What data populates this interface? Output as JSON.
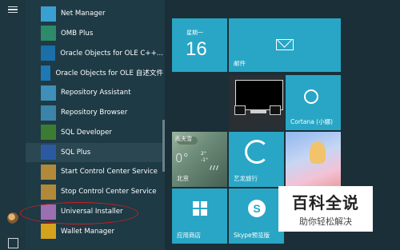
{
  "apps": [
    {
      "label": "Net Manager",
      "icon": "net-manager-icon",
      "color": "#3aa0d1"
    },
    {
      "label": "OMB Plus",
      "icon": "omb-plus-icon",
      "color": "#2d8a6a"
    },
    {
      "label": "Oracle Objects for OLE C++...",
      "icon": "oracle-objects-icon",
      "color": "#1b6fa8"
    },
    {
      "label": "Oracle Objects for OLE 自述文件",
      "icon": "oracle-objects-readme-icon",
      "color": "#1e78b5"
    },
    {
      "label": "Repository Assistant",
      "icon": "repository-assistant-icon",
      "color": "#3f8fb8"
    },
    {
      "label": "Repository Browser",
      "icon": "repository-browser-icon",
      "color": "#3b84a7"
    },
    {
      "label": "SQL Developer",
      "icon": "sql-developer-icon",
      "color": "#3c7c32"
    },
    {
      "label": "SQL Plus",
      "icon": "sql-plus-icon",
      "color": "#2c5aa0"
    },
    {
      "label": "Start Control Center Service",
      "icon": "start-service-icon",
      "color": "#b08a3a"
    },
    {
      "label": "Stop Control Center Service",
      "icon": "stop-service-icon",
      "color": "#b08a3a"
    },
    {
      "label": "Universal Installer",
      "icon": "universal-installer-icon",
      "color": "#9c6fb3"
    },
    {
      "label": "Wallet Manager",
      "icon": "wallet-manager-icon",
      "color": "#d4a21d"
    }
  ],
  "selected_app_index": 7,
  "tiles": {
    "calendar": {
      "weekday": "星期一",
      "day": "16"
    },
    "mail": {
      "label": "邮件"
    },
    "cortana": {
      "label": "Cortana (小娜)"
    },
    "weather": {
      "condition": "雨夹雪",
      "temp": "0°",
      "hi": "2°",
      "lo": "-1°",
      "city": "北京"
    },
    "travel": {
      "label": "艺龙旅行"
    },
    "store": {
      "label": "应用商店"
    },
    "skype": {
      "label": "Skype预览版"
    }
  },
  "watermark": {
    "title": "百科全说",
    "subtitle": "助你轻松解决"
  },
  "colors": {
    "tile_blue": "#29a6c5",
    "highlight": "#cc1f1f"
  }
}
